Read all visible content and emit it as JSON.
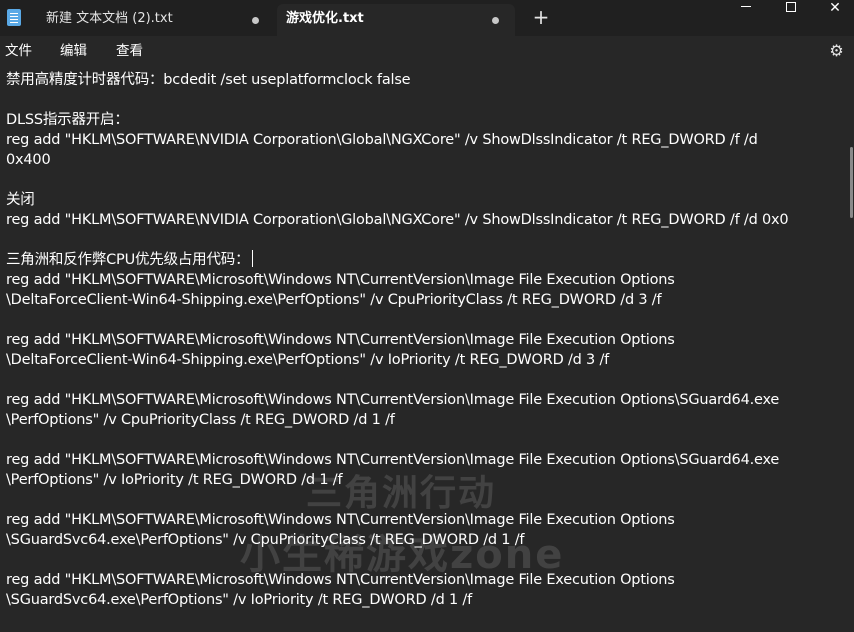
{
  "tabs": [
    {
      "label": "新建 文本文档 (2).txt",
      "active": false
    },
    {
      "label": "游戏优化.txt",
      "active": true
    }
  ],
  "new_tab_label": "+",
  "window_controls": {
    "minimize": "minimize-icon",
    "maximize": "maximize-icon",
    "close": "✕"
  },
  "menu": {
    "file": "文件",
    "edit": "编辑",
    "view": "查看"
  },
  "settings_icon": "⚙",
  "lines": [
    "禁用高精度计时器代码：bcdedit /set useplatformclock false",
    "",
    "DLSS指示器开启：",
    "reg add \"HKLM\\SOFTWARE\\NVIDIA Corporation\\Global\\NGXCore\" /v ShowDlssIndicator /t REG_DWORD /f /d",
    "0x400",
    "",
    "关闭",
    "reg add \"HKLM\\SOFTWARE\\NVIDIA Corporation\\Global\\NGXCore\" /v ShowDlssIndicator /t REG_DWORD /f /d 0x0",
    "",
    "三角洲和反作弊CPU优先级占用代码：",
    "reg add \"HKLM\\SOFTWARE\\Microsoft\\Windows NT\\CurrentVersion\\Image File Execution Options",
    "\\DeltaForceClient-Win64-Shipping.exe\\PerfOptions\" /v CpuPriorityClass /t REG_DWORD /d 3 /f",
    "",
    "reg add \"HKLM\\SOFTWARE\\Microsoft\\Windows NT\\CurrentVersion\\Image File Execution Options",
    "\\DeltaForceClient-Win64-Shipping.exe\\PerfOptions\" /v IoPriority /t REG_DWORD /d 3 /f",
    "",
    "reg add \"HKLM\\SOFTWARE\\Microsoft\\Windows NT\\CurrentVersion\\Image File Execution Options\\SGuard64.exe",
    "\\PerfOptions\" /v CpuPriorityClass /t REG_DWORD /d 1 /f",
    "",
    "reg add \"HKLM\\SOFTWARE\\Microsoft\\Windows NT\\CurrentVersion\\Image File Execution Options\\SGuard64.exe",
    "\\PerfOptions\" /v IoPriority /t REG_DWORD /d 1 /f",
    "",
    "reg add \"HKLM\\SOFTWARE\\Microsoft\\Windows NT\\CurrentVersion\\Image File Execution Options",
    "\\SGuardSvc64.exe\\PerfOptions\" /v CpuPriorityClass /t REG_DWORD /d 1 /f",
    "",
    "reg add \"HKLM\\SOFTWARE\\Microsoft\\Windows NT\\CurrentVersion\\Image File Execution Options",
    "\\SGuardSvc64.exe\\PerfOptions\" /v IoPriority /t REG_DWORD /d 1 /f"
  ],
  "watermark": {
    "line1": "三角洲行动",
    "line2": "小生稀游戏zone"
  }
}
